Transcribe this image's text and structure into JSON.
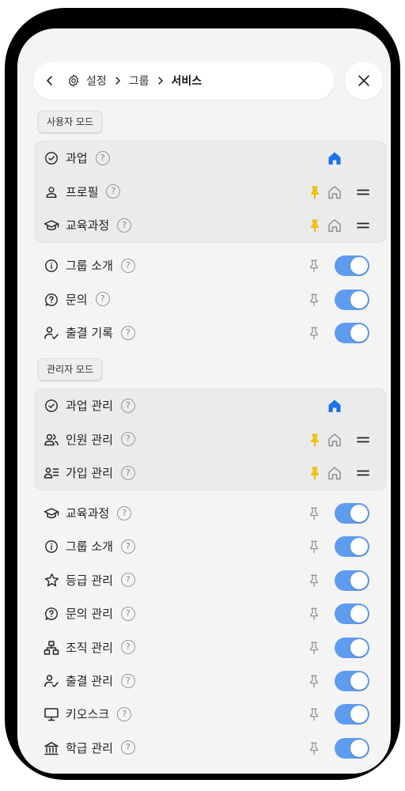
{
  "header": {
    "breadcrumb": [
      "설정",
      "그룹",
      "서비스"
    ]
  },
  "user_mode": {
    "label": "사용자 모드",
    "fixed": [
      {
        "label": "과업",
        "icon": "check-circle-icon",
        "home_active": true
      },
      {
        "label": "프로필",
        "icon": "user-icon",
        "pinned": true
      },
      {
        "label": "교육과정",
        "icon": "graduation-cap-icon",
        "pinned": true
      }
    ],
    "items": [
      {
        "label": "그룹 소개",
        "icon": "info-icon",
        "enabled": true
      },
      {
        "label": "문의",
        "icon": "question-bubble-icon",
        "enabled": true
      },
      {
        "label": "출결 기록",
        "icon": "user-check-icon",
        "enabled": true
      }
    ]
  },
  "admin_mode": {
    "label": "관리자 모드",
    "fixed": [
      {
        "label": "과업 관리",
        "icon": "check-circle-icon",
        "home_active": true
      },
      {
        "label": "인원 관리",
        "icon": "users-icon",
        "pinned": true
      },
      {
        "label": "가입 관리",
        "icon": "user-list-icon",
        "pinned": true
      }
    ],
    "items": [
      {
        "label": "교육과정",
        "icon": "graduation-cap-icon",
        "enabled": true
      },
      {
        "label": "그룹 소개",
        "icon": "info-icon",
        "enabled": true
      },
      {
        "label": "등급 관리",
        "icon": "star-icon",
        "enabled": true
      },
      {
        "label": "문의 관리",
        "icon": "question-bubble-icon",
        "enabled": true
      },
      {
        "label": "조직 관리",
        "icon": "org-chart-icon",
        "enabled": true
      },
      {
        "label": "출결 관리",
        "icon": "user-check-icon",
        "enabled": true
      },
      {
        "label": "키오스크",
        "icon": "monitor-icon",
        "enabled": true
      },
      {
        "label": "학급 관리",
        "icon": "building-icon",
        "enabled": true
      }
    ]
  },
  "colors": {
    "accent": "#5f9cf0",
    "home_active": "#1a73e8",
    "pin_active": "#f5c400"
  }
}
